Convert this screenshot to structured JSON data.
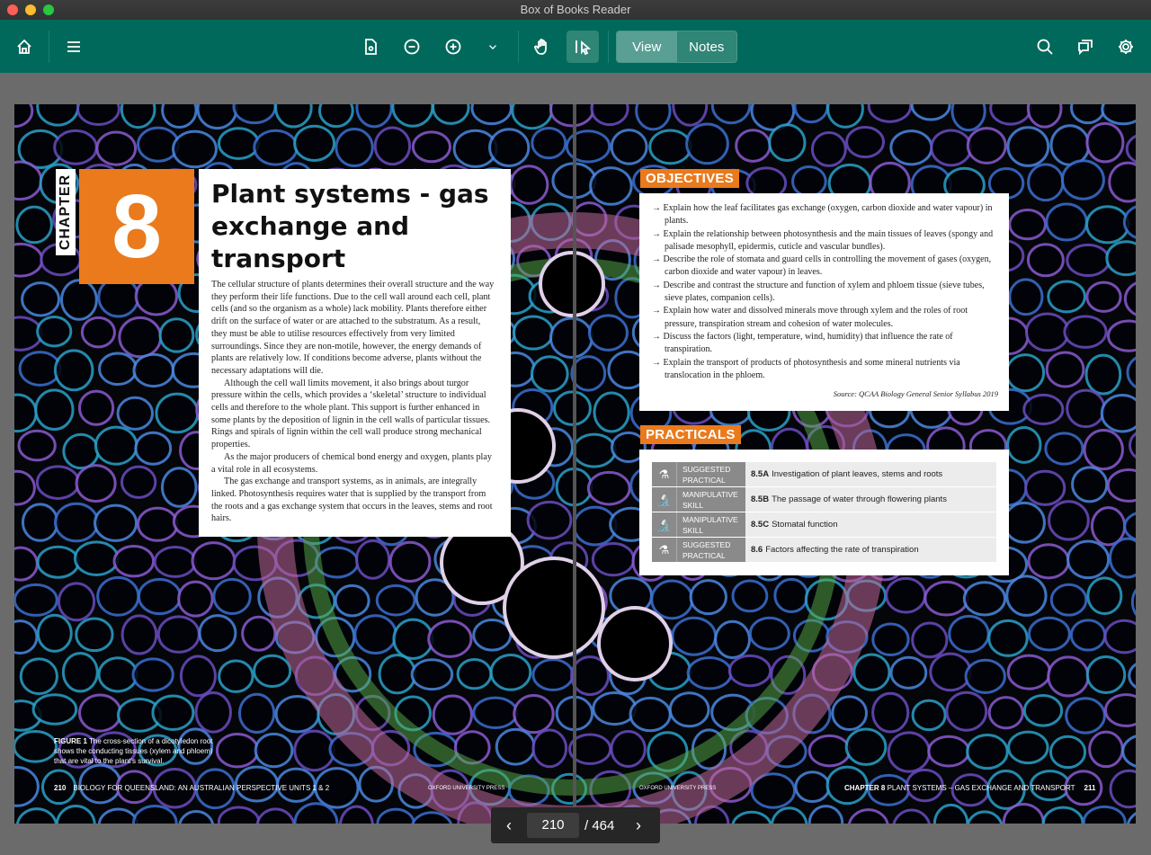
{
  "window": {
    "title": "Box of Books Reader"
  },
  "toolbar": {
    "view_label": "View",
    "notes_label": "Notes",
    "active_mode": "View",
    "icons": [
      "home-icon",
      "menu-icon",
      "page-icon",
      "zoom-out-icon",
      "zoom-in-icon",
      "chevron-down-icon",
      "hand-icon",
      "select-icon",
      "search-icon",
      "comments-icon",
      "gear-icon"
    ]
  },
  "page_left": {
    "chapter_label": "CHAPTER",
    "chapter_number": "8",
    "title": "Plant systems - gas exchange and transport",
    "paragraphs": [
      "The cellular structure of plants determines their overall structure and the way they perform their life functions. Due to the cell wall around each cell, plant cells (and so the organism as a whole) lack mobility. Plants therefore either drift on the surface of water or are attached to the substratum. As a result, they must be able to utilise resources effectively from very limited surroundings. Since they are non-motile, however, the energy demands of plants are relatively low. If conditions become adverse, plants without the necessary adaptations will die.",
      "Although the cell wall limits movement, it also brings about turgor pressure within the cells, which provides a ‘skeletal’ structure to individual cells and therefore to the whole plant. This support is further enhanced in some plants by the deposition of lignin in the cell walls of particular tissues. Rings and spirals of lignin within the cell wall produce strong mechanical properties.",
      "As the major producers of chemical bond energy and oxygen, plants play a vital role in all ecosystems.",
      "The gas exchange and transport systems, as in animals, are integrally linked. Photosynthesis requires water that is supplied by the transport from the roots and a gas exchange system that occurs in the leaves, stems and root hairs."
    ],
    "figure_label": "FIGURE 1",
    "figure_caption": "The cross-section of a dicotyledon root shows the conducting tissues (xylem and phloem) that are vital to the plant’s survival.",
    "page_number": "210",
    "running_title": "BIOLOGY FOR QUEENSLAND: AN AUSTRALIAN PERSPECTIVE UNITS 1 & 2",
    "publisher": "OXFORD UNIVERSITY PRESS"
  },
  "page_right": {
    "objectives_label": "OBJECTIVES",
    "objectives": [
      "Explain how the leaf facilitates gas exchange (oxygen, carbon dioxide and water vapour) in plants.",
      "Explain the relationship between photosynthesis and the main tissues of leaves (spongy and palisade mesophyll, epidermis, cuticle and vascular bundles).",
      "Describe the role of stomata and guard cells in controlling the movement of gases (oxygen, carbon dioxide and water vapour) in leaves.",
      "Describe and contrast the structure and function of xylem and phloem tissue (sieve tubes, sieve plates, companion cells).",
      "Explain how water and dissolved minerals move through xylem and the roles of root pressure, transpiration stream and cohesion of water molecules.",
      "Discuss the factors (light, temperature, wind, humidity) that influence the rate of transpiration.",
      "Explain the transport of products of photosynthesis and some mineral nutrients via translocation in the phloem."
    ],
    "source": "Source: QCAA Biology General Senior Syllabus 2019",
    "practicals_label": "PRACTICALS",
    "practicals": [
      {
        "icon": "flask-icon",
        "type": "SUGGESTED PRACTICAL",
        "code": "8.5A",
        "text": "Investigation of plant leaves, stems and roots"
      },
      {
        "icon": "microscope-icon",
        "type": "MANIPULATIVE SKILL",
        "code": "8.5B",
        "text": "The passage of water through flowering plants"
      },
      {
        "icon": "microscope-icon",
        "type": "MANIPULATIVE SKILL",
        "code": "8.5C",
        "text": "Stomatal function"
      },
      {
        "icon": "flask-icon",
        "type": "SUGGESTED PRACTICAL",
        "code": "8.6",
        "text": "Factors affecting the rate of transpiration"
      }
    ],
    "publisher": "OXFORD UNIVERSITY PRESS",
    "running_chapter": "CHAPTER 8",
    "running_title": "PLANT SYSTEMS – GAS EXCHANGE AND TRANSPORT",
    "page_number": "211"
  },
  "pager": {
    "current_page": "210",
    "total": "/ 464",
    "prev": "‹",
    "next": "›"
  },
  "colors": {
    "toolbar": "#00695b",
    "accent_orange": "#ea7a1c"
  }
}
